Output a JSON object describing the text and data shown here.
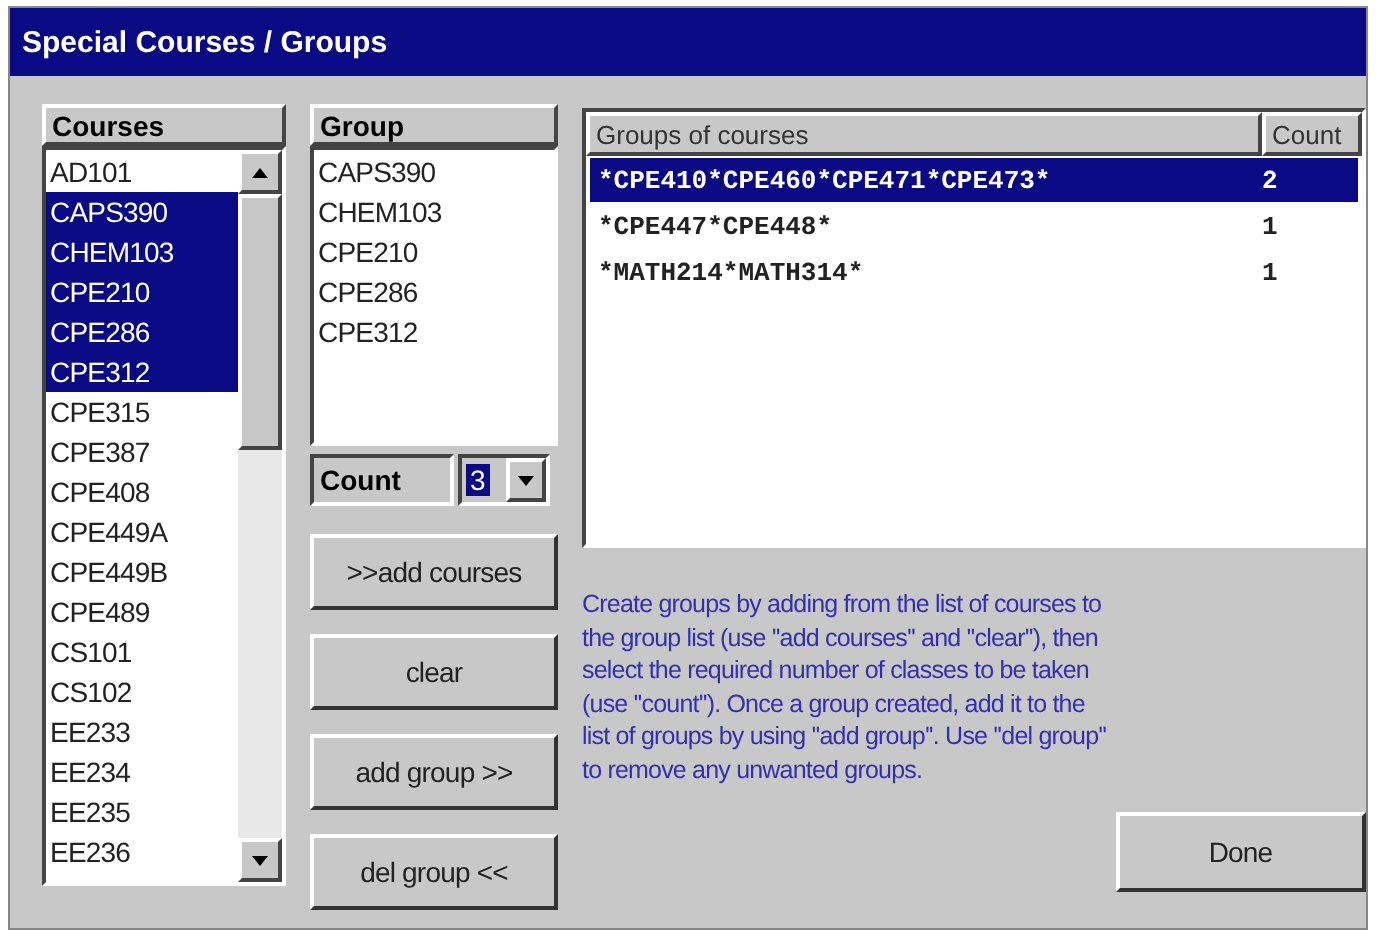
{
  "window": {
    "title": "Special Courses / Groups"
  },
  "courses": {
    "header": "Courses",
    "items": [
      {
        "label": "AD101",
        "selected": false
      },
      {
        "label": "CAPS390",
        "selected": true
      },
      {
        "label": "CHEM103",
        "selected": true
      },
      {
        "label": "CPE210",
        "selected": true
      },
      {
        "label": "CPE286",
        "selected": true
      },
      {
        "label": "CPE312",
        "selected": true
      },
      {
        "label": "CPE315",
        "selected": false
      },
      {
        "label": "CPE387",
        "selected": false
      },
      {
        "label": "CPE408",
        "selected": false
      },
      {
        "label": "CPE449A",
        "selected": false
      },
      {
        "label": "CPE449B",
        "selected": false
      },
      {
        "label": "CPE489",
        "selected": false
      },
      {
        "label": "CS101",
        "selected": false
      },
      {
        "label": "CS102",
        "selected": false
      },
      {
        "label": "EE233",
        "selected": false
      },
      {
        "label": "EE234",
        "selected": false
      },
      {
        "label": "EE235",
        "selected": false
      },
      {
        "label": "EE236",
        "selected": false
      }
    ]
  },
  "group": {
    "header": "Group",
    "items": [
      "CAPS390",
      "CHEM103",
      "CPE210",
      "CPE286",
      "CPE312"
    ]
  },
  "count": {
    "label": "Count",
    "value": "3"
  },
  "buttons": [
    ">>add courses",
    "clear",
    "add group >>",
    "del group <<"
  ],
  "groups_table": {
    "columns": [
      "Groups of courses",
      "Count"
    ],
    "rows": [
      {
        "group": "*CPE410*CPE460*CPE471*CPE473*",
        "count": "2",
        "selected": true
      },
      {
        "group": "*CPE447*CPE448*",
        "count": "1",
        "selected": false
      },
      {
        "group": "*MATH214*MATH314*",
        "count": "1",
        "selected": false
      }
    ]
  },
  "instructions": "Create groups by adding from  the list of courses to the group list (use ''add courses'' and ''clear''), then select the required number of classes to be taken (use ''count''). Once a group created, add it to the list of groups by using ''add group''. Use ''del group'' to remove any unwanted groups.",
  "done_button": "Done"
}
